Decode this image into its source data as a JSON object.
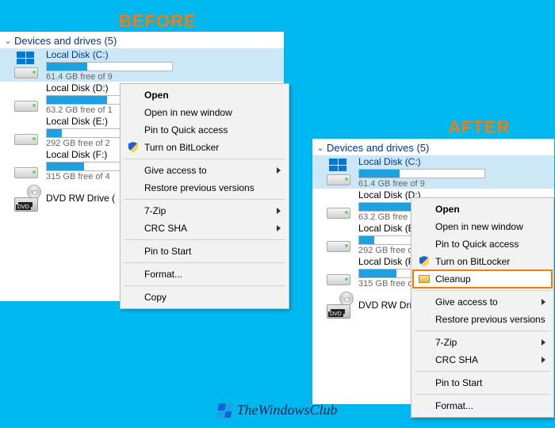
{
  "labels": {
    "before": "BEFORE",
    "after": "AFTER"
  },
  "section_header": "Devices and drives (5)",
  "drives": [
    {
      "name": "Local Disk (C:)",
      "free_text": "61.4 GB free of 9",
      "fill_pct": 32,
      "kind": "os",
      "selected": true
    },
    {
      "name": "Local Disk (D:)",
      "free_text": "63.2 GB free of 1",
      "fill_pct": 48,
      "kind": "hdd",
      "selected": false
    },
    {
      "name": "Local Disk (E:)",
      "free_text": "292 GB free of 2",
      "fill_pct": 12,
      "kind": "hdd",
      "selected": false
    },
    {
      "name": "Local Disk (F:)",
      "free_text": "315 GB free of 4",
      "fill_pct": 30,
      "kind": "hdd",
      "selected": false
    },
    {
      "name": "DVD RW Drive (",
      "free_text": "",
      "fill_pct": 0,
      "kind": "dvd",
      "selected": false
    }
  ],
  "menu_before": [
    {
      "label": "Open",
      "bold": true
    },
    {
      "label": "Open in new window"
    },
    {
      "label": "Pin to Quick access"
    },
    {
      "label": "Turn on BitLocker",
      "icon": "shield"
    },
    {
      "sep": true
    },
    {
      "label": "Give access to",
      "submenu": true
    },
    {
      "label": "Restore previous versions"
    },
    {
      "sep": true
    },
    {
      "label": "7-Zip",
      "submenu": true
    },
    {
      "label": "CRC SHA",
      "submenu": true
    },
    {
      "sep": true
    },
    {
      "label": "Pin to Start"
    },
    {
      "sep": true
    },
    {
      "label": "Format..."
    },
    {
      "sep": true
    },
    {
      "label": "Copy"
    }
  ],
  "menu_after": [
    {
      "label": "Open",
      "bold": true
    },
    {
      "label": "Open in new window"
    },
    {
      "label": "Pin to Quick access"
    },
    {
      "label": "Turn on BitLocker",
      "icon": "shield"
    },
    {
      "label": "Cleanup",
      "icon": "cleanup",
      "highlight": true
    },
    {
      "sep": true
    },
    {
      "label": "Give access to",
      "submenu": true
    },
    {
      "label": "Restore previous versions"
    },
    {
      "sep": true
    },
    {
      "label": "7-Zip",
      "submenu": true
    },
    {
      "label": "CRC SHA",
      "submenu": true
    },
    {
      "sep": true
    },
    {
      "label": "Pin to Start"
    },
    {
      "sep": true
    },
    {
      "label": "Format..."
    }
  ],
  "watermark": "TheWindowsClub"
}
